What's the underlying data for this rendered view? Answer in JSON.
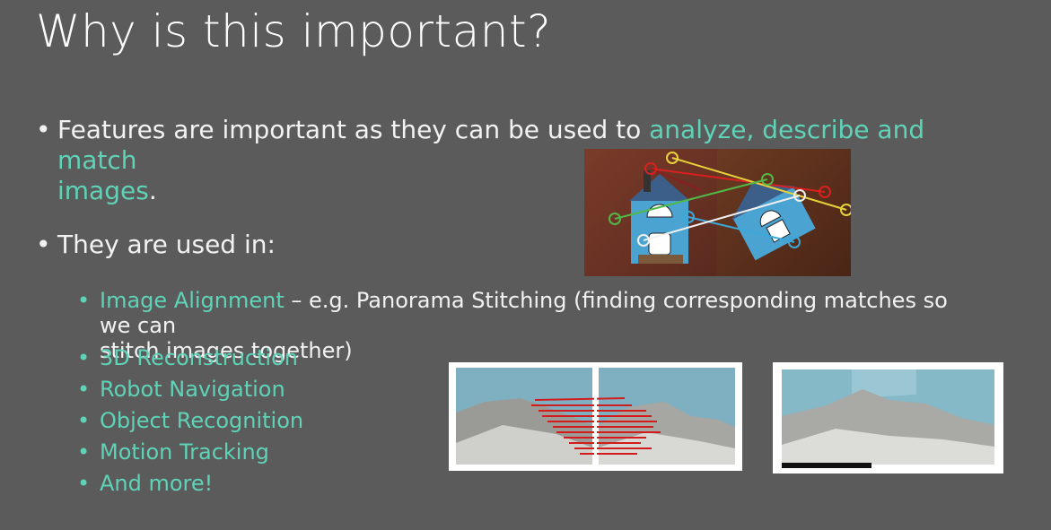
{
  "slide": {
    "title": "Why is this important?",
    "bullet1": {
      "prefix": "Features are important as they can be used to ",
      "highlight": "analyze, describe and match",
      "highlight2": "images",
      "suffix": "."
    },
    "bullet2": {
      "text": "They are used in:"
    },
    "subitems": {
      "item1": {
        "highlight": "Image Alignment",
        "rest": " – e.g. Panorama Stitching (finding corresponding matches so we can",
        "line2": "stitch images together)"
      },
      "item2": "3D Reconstruction",
      "item3": "Robot Navigation",
      "item4": "Object Recognition",
      "item5": "Motion Tracking",
      "item6": "And more!"
    },
    "bullet_char": "•",
    "colors": {
      "background": "#5b5b5b",
      "accent": "#5fd3b8",
      "text": "#f2f2f2"
    }
  }
}
